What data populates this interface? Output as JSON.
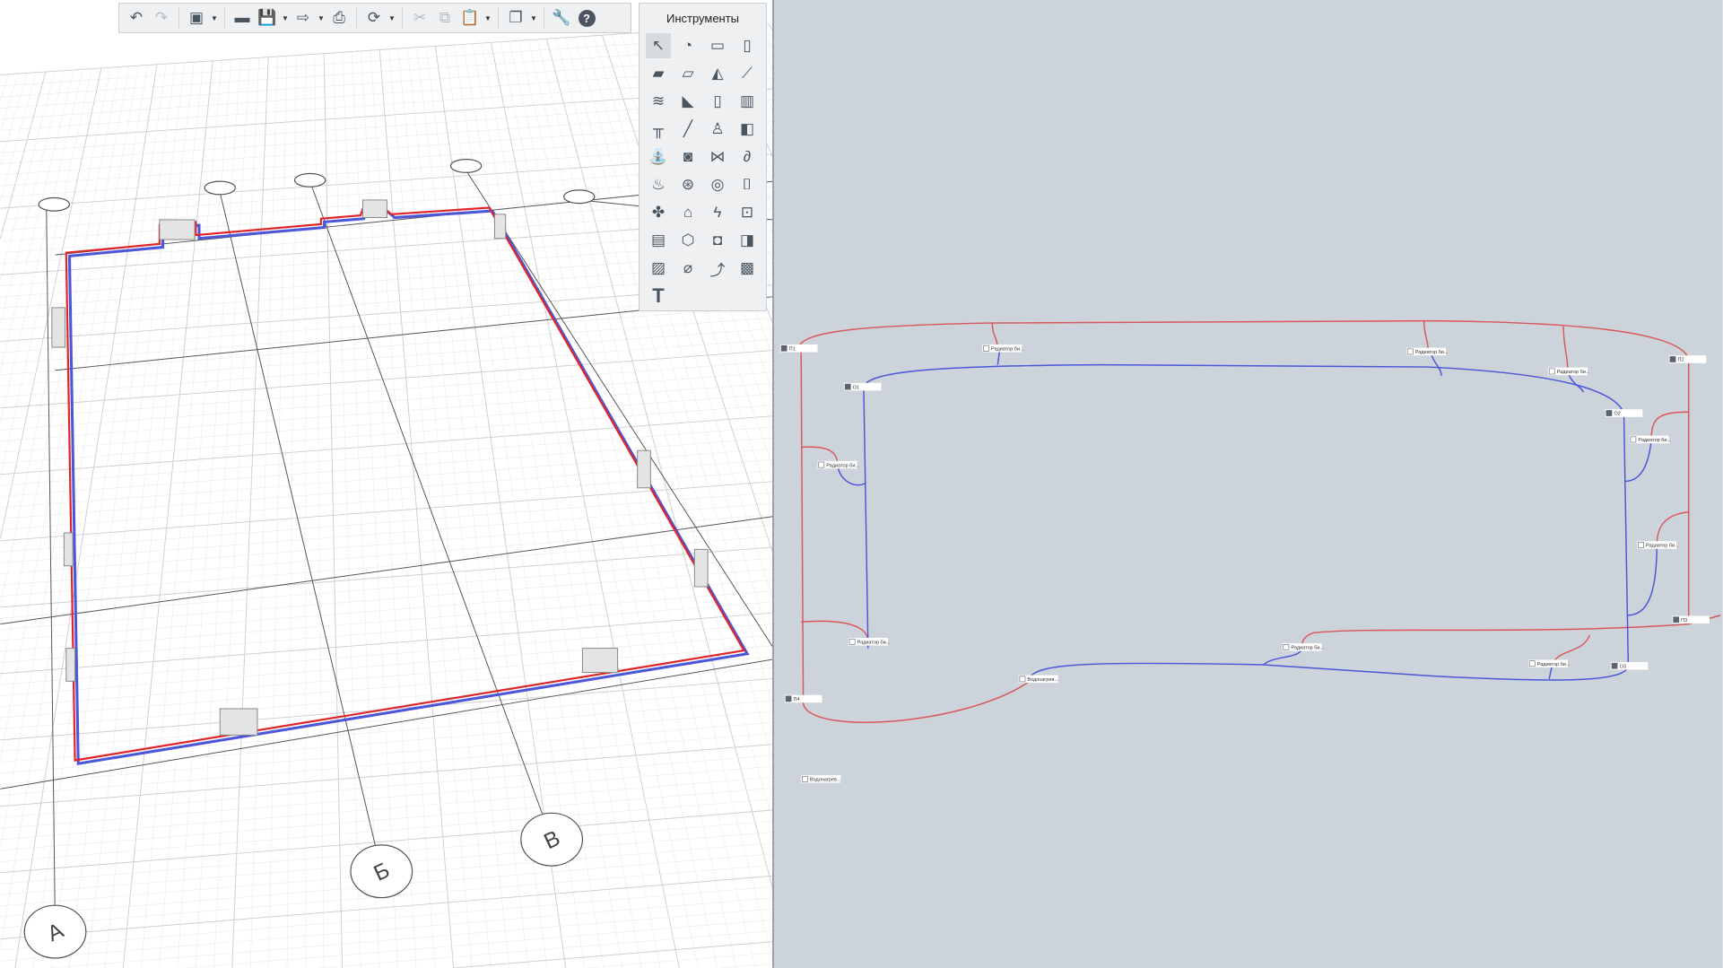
{
  "toolbar": {
    "buttons": [
      {
        "icon": "undo-icon",
        "glyph": "↶"
      },
      {
        "icon": "redo-icon",
        "glyph": "↷",
        "disabled": true
      },
      {
        "icon": "3d-view-icon",
        "glyph": "▣",
        "dropdown": true
      },
      {
        "icon": "open-folder-icon",
        "glyph": "▬"
      },
      {
        "icon": "save-icon",
        "glyph": "💾",
        "dropdown": true
      },
      {
        "icon": "export-icon",
        "glyph": "⇨",
        "dropdown": true
      },
      {
        "icon": "print-icon",
        "glyph": "⎙"
      },
      {
        "icon": "cloud-sync-icon",
        "glyph": "⟳",
        "dropdown": true
      },
      {
        "icon": "cut-icon",
        "glyph": "✂",
        "disabled": true
      },
      {
        "icon": "copy-icon",
        "glyph": "⧉",
        "disabled": true
      },
      {
        "icon": "paste-icon",
        "glyph": "📋",
        "disabled": true,
        "dropdown": true
      },
      {
        "icon": "layers-icon",
        "glyph": "❐",
        "dropdown": true
      },
      {
        "icon": "wrench-icon",
        "glyph": "🔧"
      },
      {
        "icon": "help-icon",
        "glyph": "?"
      }
    ]
  },
  "tools_panel": {
    "title": "Инструменты",
    "tools": [
      {
        "icon": "select-arrow-icon",
        "glyph": "↖"
      },
      {
        "icon": "styles-icon",
        "glyph": "◔"
      },
      {
        "icon": "wall-icon",
        "glyph": "▭"
      },
      {
        "icon": "column-icon",
        "glyph": "▯"
      },
      {
        "icon": "slab-icon",
        "glyph": "▰"
      },
      {
        "icon": "slab-opening-icon",
        "glyph": "▱"
      },
      {
        "icon": "roof-icon",
        "glyph": "◭"
      },
      {
        "icon": "beam-icon",
        "glyph": "⟋"
      },
      {
        "icon": "stairs-icon",
        "glyph": "≋"
      },
      {
        "icon": "ramp-icon",
        "glyph": "◣"
      },
      {
        "icon": "door-icon",
        "glyph": "▯"
      },
      {
        "icon": "window-icon",
        "glyph": "▥"
      },
      {
        "icon": "railing-icon",
        "glyph": "╥"
      },
      {
        "icon": "line-icon",
        "glyph": "╱"
      },
      {
        "icon": "furniture-icon",
        "glyph": "♙"
      },
      {
        "icon": "duct-icon",
        "glyph": "◧"
      },
      {
        "icon": "plumbing-fixture-icon",
        "glyph": "⛲"
      },
      {
        "icon": "washing-machine-icon",
        "glyph": "◙"
      },
      {
        "icon": "valve-icon",
        "glyph": "⋈"
      },
      {
        "icon": "pipe-fitting-icon",
        "glyph": "∂"
      },
      {
        "icon": "heating-equipment-icon",
        "glyph": "♨"
      },
      {
        "icon": "fan-icon",
        "glyph": "⊛"
      },
      {
        "icon": "pipe-icon",
        "glyph": "◎"
      },
      {
        "icon": "duct-fitting-icon",
        "glyph": "⌷"
      },
      {
        "icon": "ventilation-equipment-icon",
        "glyph": "✤"
      },
      {
        "icon": "lamp-icon",
        "glyph": "⌂"
      },
      {
        "icon": "electrical-equipment-icon",
        "glyph": "ϟ"
      },
      {
        "icon": "socket-icon",
        "glyph": "⊡"
      },
      {
        "icon": "panel-icon",
        "glyph": "▤"
      },
      {
        "icon": "fire-alarm-icon",
        "glyph": "⬡"
      },
      {
        "icon": "camera-icon",
        "glyph": "◘"
      },
      {
        "icon": "wall-panel-icon",
        "glyph": "◨"
      },
      {
        "icon": "image-icon",
        "glyph": "▨"
      },
      {
        "icon": "dimension-icon",
        "glyph": "⌀"
      },
      {
        "icon": "curve-icon",
        "glyph": "⤴"
      },
      {
        "icon": "hatch-icon",
        "glyph": "▩"
      },
      {
        "icon": "text-icon",
        "glyph": "T"
      }
    ]
  },
  "viewport3d": {
    "axes_bottom": [
      "А",
      "Б",
      "В"
    ]
  },
  "schematic": {
    "colors": {
      "supply": "#d9575c",
      "return": "#4b56d8"
    },
    "nodes": [
      {
        "label": "П1",
        "kind": "collector"
      },
      {
        "label": "О1",
        "kind": "collector"
      },
      {
        "label": "П2",
        "kind": "collector"
      },
      {
        "label": "О2",
        "kind": "collector"
      },
      {
        "label": "П3",
        "kind": "collector"
      },
      {
        "label": "О3",
        "kind": "collector"
      },
      {
        "label": "П4",
        "kind": "collector"
      },
      {
        "label": "Радиатор би...",
        "kind": "radiator"
      },
      {
        "label": "Радиатор би...",
        "kind": "radiator"
      },
      {
        "label": "Радиатор би...",
        "kind": "radiator"
      },
      {
        "label": "Радиатор би...",
        "kind": "radiator"
      },
      {
        "label": "Радиатор би...",
        "kind": "radiator"
      },
      {
        "label": "Радиатор би...",
        "kind": "radiator"
      },
      {
        "label": "Радиатор би...",
        "kind": "radiator"
      },
      {
        "label": "Радиатор би...",
        "kind": "radiator"
      },
      {
        "label": "Радиатор би...",
        "kind": "radiator"
      },
      {
        "label": "Водонагрев...",
        "kind": "heater"
      },
      {
        "label": "Водонагрев...",
        "kind": "heater"
      }
    ]
  }
}
